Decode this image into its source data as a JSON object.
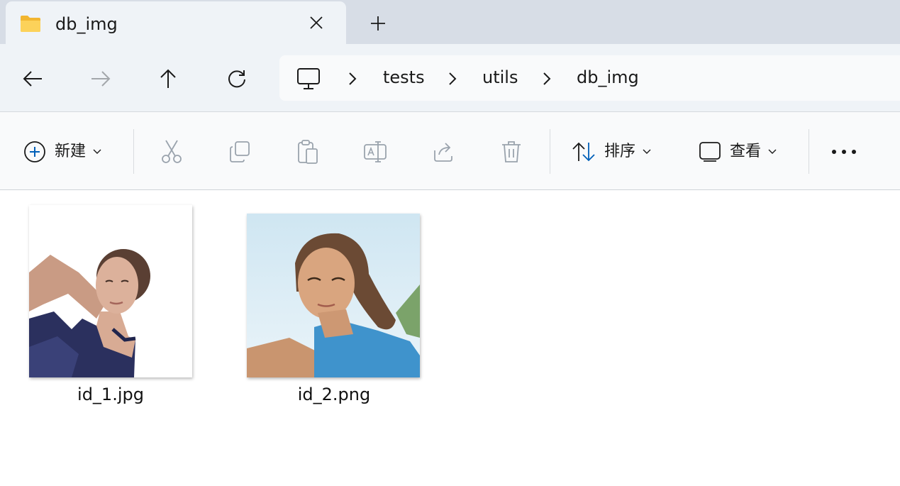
{
  "window": {
    "tab": {
      "title": "db_img",
      "icon": "folder-icon"
    },
    "new_tab_icon": "plus-icon"
  },
  "nav": {
    "back_icon": "arrow-left-icon",
    "forward_icon": "arrow-right-icon",
    "up_icon": "arrow-up-icon",
    "refresh_icon": "refresh-icon",
    "breadcrumb": [
      "tests",
      "utils",
      "db_img"
    ],
    "root_icon": "this-pc-icon"
  },
  "toolbar": {
    "new_label": "新建",
    "sort_label": "排序",
    "view_label": "查看",
    "icons": [
      "cut-icon",
      "copy-icon",
      "paste-icon",
      "rename-icon",
      "share-icon",
      "delete-icon",
      "more-icon"
    ]
  },
  "files": [
    {
      "name": "id_1.jpg"
    },
    {
      "name": "id_2.png"
    }
  ],
  "colors": {
    "tabstrip_bg": "#d7dde6",
    "nav_bg": "#eff3f7",
    "cmdbar_bg": "#f9fafb",
    "accent": "#005fb8",
    "folder": "#f8c641"
  }
}
